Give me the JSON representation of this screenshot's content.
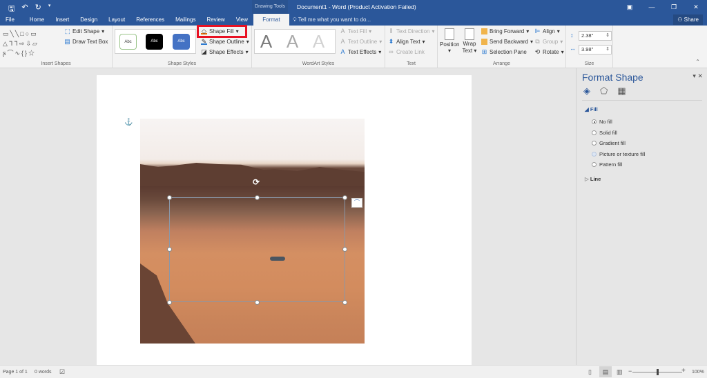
{
  "window": {
    "title": "Document1 - Word (Product Activation Failed)",
    "contextual_group": "Drawing Tools",
    "controls": [
      "ribbon-display-options",
      "minimize",
      "restore",
      "close"
    ]
  },
  "qat": {
    "save": "save-icon",
    "undo": "undo-icon",
    "redo": "redo-icon",
    "customize": "dropdown-icon"
  },
  "tabs": [
    "File",
    "Home",
    "Insert",
    "Design",
    "Layout",
    "References",
    "Mailings",
    "Review",
    "View",
    "Format"
  ],
  "active_tab": "Format",
  "tell_me": "Tell me what you want to do...",
  "share": "Share",
  "ribbon": {
    "insert_shapes": {
      "label": "Insert Shapes",
      "edit_shape": "Edit Shape",
      "draw_text_box": "Draw Text Box"
    },
    "shape_styles": {
      "label": "Shape Styles",
      "presets": [
        "Abc",
        "Abc",
        "Abc"
      ],
      "shape_fill": "Shape Fill",
      "shape_outline": "Shape Outline",
      "shape_effects": "Shape Effects"
    },
    "wordart": {
      "label": "WordArt Styles",
      "presets": [
        "A",
        "A",
        "A"
      ],
      "text_fill": "Text Fill",
      "text_outline": "Text Outline",
      "text_effects": "Text Effects"
    },
    "text": {
      "label": "Text",
      "text_direction": "Text Direction",
      "align_text": "Align Text",
      "create_link": "Create Link"
    },
    "arrange": {
      "label": "Arrange",
      "position": "Position",
      "wrap_text_1": "Wrap",
      "wrap_text_2": "Text",
      "bring_forward": "Bring Forward",
      "send_backward": "Send Backward",
      "selection_pane": "Selection Pane",
      "align": "Align",
      "group": "Group",
      "rotate": "Rotate"
    },
    "size": {
      "label": "Size",
      "height": "2.38\"",
      "width": "3.98\""
    }
  },
  "highlight": {
    "target": "Shape Fill",
    "color": "#e81123"
  },
  "format_pane": {
    "title": "Format Shape",
    "tabs": [
      "fill-line-icon",
      "effects-icon",
      "layout-properties-icon"
    ],
    "fill_section": "Fill",
    "fill_options": [
      {
        "label": "No fill",
        "selected": true
      },
      {
        "label": "Solid fill",
        "selected": false
      },
      {
        "label": "Gradient fill",
        "selected": false
      },
      {
        "label": "Picture or texture fill",
        "selected": false
      },
      {
        "label": "Pattern fill",
        "selected": false
      }
    ],
    "line_section": "Line"
  },
  "status": {
    "page": "Page 1 of 1",
    "words": "0 words",
    "zoom": "100%",
    "zoom_minus": "−",
    "zoom_plus": "+"
  },
  "colors": {
    "accent": "#2b579a"
  }
}
